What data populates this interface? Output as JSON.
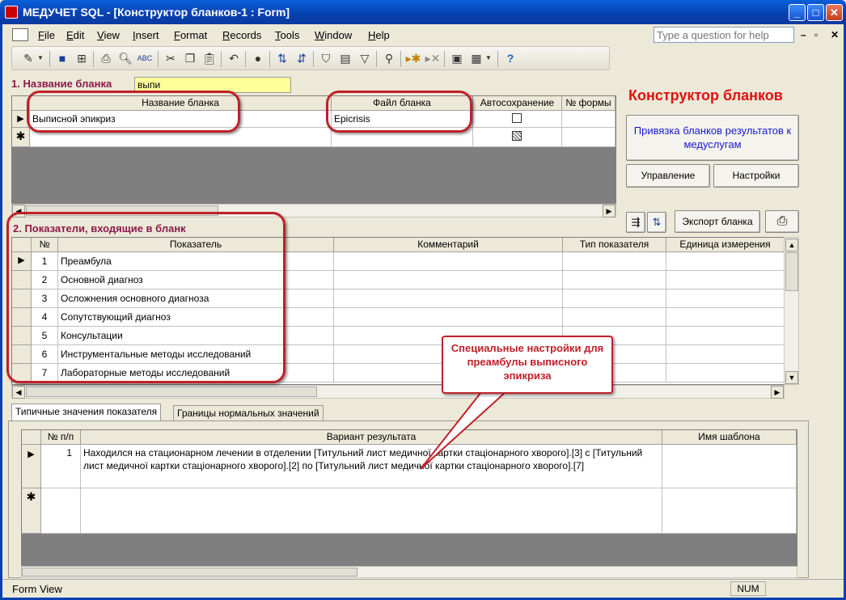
{
  "window": {
    "title": "МЕДУЧЕТ SQL - [Конструктор бланков-1 : Form]"
  },
  "menu": {
    "items": [
      "File",
      "Edit",
      "View",
      "Insert",
      "Format",
      "Records",
      "Tools",
      "Window",
      "Help"
    ]
  },
  "help": {
    "placeholder": "Type a question for help"
  },
  "section1": {
    "label": "1. Название бланка",
    "filter_value": "выпи"
  },
  "blanks": {
    "headers": [
      "Название бланка",
      "Файл бланка",
      "Автосохранение",
      "№ формы"
    ],
    "rows": [
      {
        "name": "Выписной эпикриз",
        "file": "Epicrisis",
        "autosave": false
      }
    ]
  },
  "right": {
    "title": "Конструктор бланков",
    "link_button": "Привязка бланков результатов к медуслугам",
    "manage_button": "Управление",
    "settings_button": "Настройки",
    "export_button": "Экспорт бланка"
  },
  "section2": {
    "label": "2. Показатели, входящие в бланк"
  },
  "indicators": {
    "headers": [
      "№",
      "Показатель",
      "Комментарий",
      "Тип показателя",
      "Единица измерения"
    ],
    "rows": [
      {
        "n": "1",
        "name": "Преамбула"
      },
      {
        "n": "2",
        "name": "Основной диагноз"
      },
      {
        "n": "3",
        "name": "Осложнения основного диагноза"
      },
      {
        "n": "4",
        "name": "Сопутствующий диагноз"
      },
      {
        "n": "5",
        "name": "Консультации"
      },
      {
        "n": "6",
        "name": "Инструментальные методы исследований"
      },
      {
        "n": "7",
        "name": "Лабораторные методы исследований"
      }
    ]
  },
  "tabs": {
    "typical": "Типичные значения показателя",
    "bounds": "Границы нормальных значений"
  },
  "results": {
    "headers": [
      "№ п/п",
      "Вариант результата",
      "Имя шаблона"
    ],
    "rows": [
      {
        "n": "1",
        "text": "Находился на стационарном лечении в отделении [Титульний лист медичної картки стаціонарного хворого].[3] с [Титульний лист медичної картки стаціонарного хворого].[2] по [Титульний лист медичної картки стаціонарного хворого].[7]"
      }
    ]
  },
  "callout": {
    "text": "Специальные настройки для преамбулы выписного эпикриза"
  },
  "status": {
    "left": "Form View",
    "num": "NUM"
  }
}
